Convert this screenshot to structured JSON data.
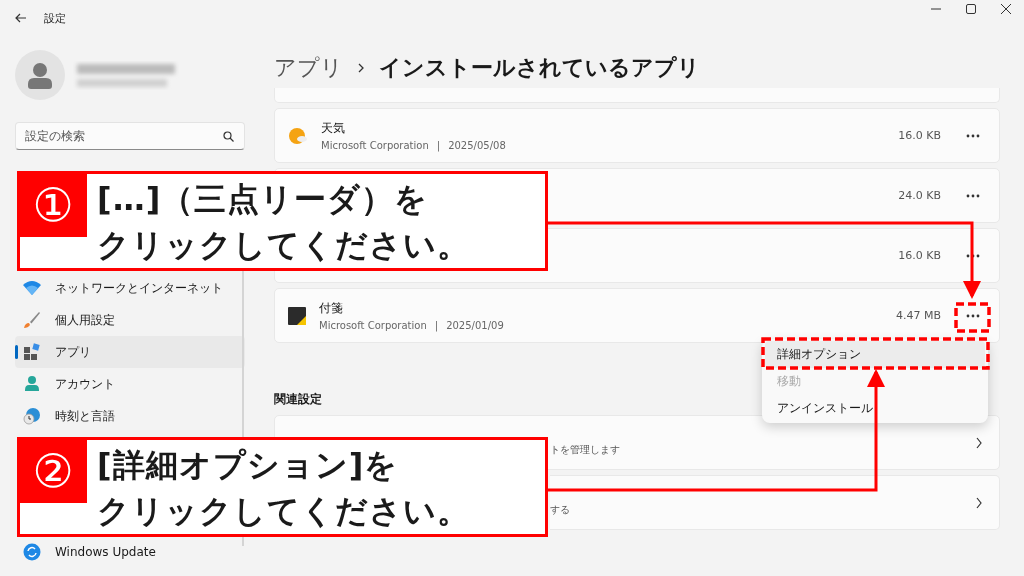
{
  "window": {
    "title": "設定"
  },
  "search": {
    "placeholder": "設定の検索"
  },
  "sidebar": {
    "items": [
      {
        "label": "ネットワークとインターネット",
        "kind": "network",
        "selected": false
      },
      {
        "label": "個人用設定",
        "kind": "personalize",
        "selected": false
      },
      {
        "label": "アプリ",
        "kind": "apps",
        "selected": true
      },
      {
        "label": "アカウント",
        "kind": "account",
        "selected": false
      },
      {
        "label": "時刻と言語",
        "kind": "time",
        "selected": false
      },
      {
        "label": "Windows Update",
        "kind": "update",
        "selected": false
      }
    ]
  },
  "breadcrumb": [
    "アプリ",
    "インストールされているアプリ"
  ],
  "apps": [
    {
      "kind": "weather",
      "name": "天気",
      "publisher": "Microsoft Corporation",
      "separator": "|",
      "date": "2025/05/08",
      "size": "16.0 KB"
    },
    {
      "kind": "hidden",
      "size": "24.0 KB"
    },
    {
      "kind": "hidden",
      "size": "16.0 KB"
    },
    {
      "kind": "sticky",
      "name": "付箋",
      "publisher": "Microsoft Corporation",
      "separator": "|",
      "date": "2025/01/09",
      "size": "4.47 MB"
    }
  ],
  "menu": {
    "items": [
      {
        "label": "詳細オプション",
        "selected": true,
        "disabled": false
      },
      {
        "label": "移動",
        "selected": false,
        "disabled": true
      },
      {
        "label": "アンインストール",
        "selected": false,
        "disabled": false
      }
    ]
  },
  "related": {
    "heading": "関連設定",
    "rows": [
      {
        "description": "トを管理します"
      },
      {
        "description": "する"
      }
    ]
  },
  "callouts": [
    {
      "number": "①",
      "lines": [
        "[…]（三点リーダ）を",
        "クリックしてください。"
      ]
    },
    {
      "number": "②",
      "lines": [
        "[詳細オプション]を",
        "クリックしてください。"
      ]
    }
  ]
}
